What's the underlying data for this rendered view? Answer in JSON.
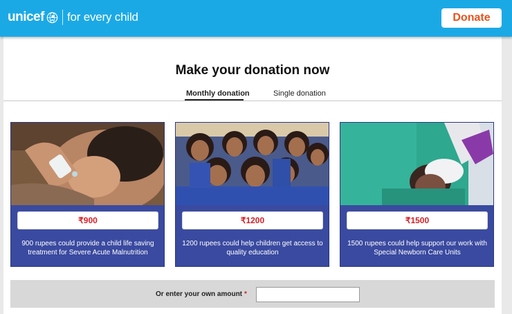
{
  "header": {
    "brand": "unicef",
    "tagline": "for every child",
    "donate_label": "Donate",
    "brand_color": "#1ba9e6",
    "donate_color": "#e8521d"
  },
  "main": {
    "title": "Make your donation now",
    "tabs": [
      {
        "label": "Monthly donation",
        "active": true
      },
      {
        "label": "Single donation",
        "active": false
      }
    ],
    "cards": [
      {
        "image": "newborn-receiving-drops-photo",
        "amount": "₹900",
        "description": "900 rupees could provide a child life saving treatment for Severe Acute Malnutrition"
      },
      {
        "image": "group-of-schoolgirls-photo",
        "amount": "₹1200",
        "description": "1200 rupees could help children get access to quality education"
      },
      {
        "image": "nurse-with-newborn-photo",
        "amount": "₹1500",
        "description": "1500 rupees could help support our work with Special Newborn Care Units"
      }
    ],
    "own_amount": {
      "label": "Or enter your own amount",
      "required_mark": "*",
      "value": "",
      "placeholder": ""
    },
    "card_color": "#3a4aa0",
    "amount_color": "#d51f26"
  }
}
